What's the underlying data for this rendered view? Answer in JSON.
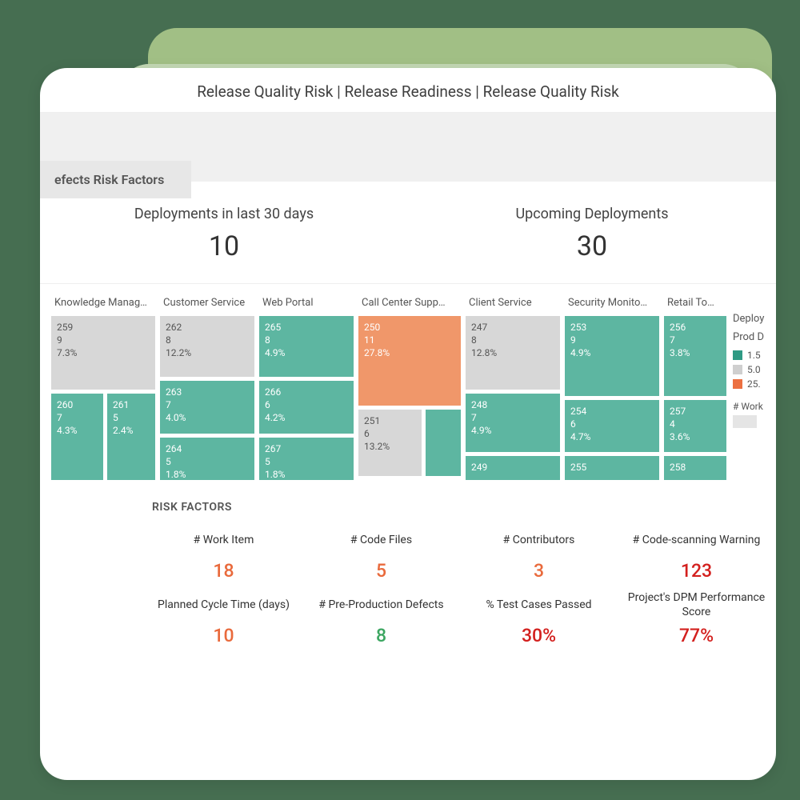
{
  "breadcrumb": "Release Quality Risk | Release Readiness | Release Quality Risk",
  "tab_label": "efects Risk Factors",
  "kpis": [
    {
      "label": "Deployments in last 30 days",
      "value": "10"
    },
    {
      "label": "Upcoming Deployments",
      "value": "30"
    }
  ],
  "legend": {
    "title1": "Deploy",
    "title2": "Prod D",
    "items": [
      {
        "swatch": "teal",
        "label": "1.5"
      },
      {
        "swatch": "gray",
        "label": "5.0"
      },
      {
        "swatch": "orange",
        "label": "25."
      }
    ],
    "footer": "# Work"
  },
  "risk_section_title": "RISK FACTORS",
  "risk_factors": [
    {
      "label": "# Work Item",
      "value": "18",
      "color": "orange"
    },
    {
      "label": "# Code Files",
      "value": "5",
      "color": "orange"
    },
    {
      "label": "# Contributors",
      "value": "3",
      "color": "orange"
    },
    {
      "label": "# Code-scanning Warning",
      "value": "123",
      "color": "red"
    },
    {
      "label": "Planned Cycle Time (days)",
      "value": "10",
      "color": "orange"
    },
    {
      "label": "# Pre-Production Defects",
      "value": "8",
      "color": "green"
    },
    {
      "label": "% Test Cases Passed",
      "value": "30%",
      "color": "red"
    },
    {
      "label": "Project's DPM Performance Score",
      "value": "77%",
      "color": "red"
    }
  ],
  "chart_data": {
    "type": "treemap",
    "title": "",
    "legend_title": "Deploy / Prod D",
    "color_scale": [
      {
        "label": "1.5",
        "color": "#2f9a84"
      },
      {
        "label": "5.0",
        "color": "#cfcfcf"
      },
      {
        "label": "25.",
        "color": "#ec7041"
      }
    ],
    "size_metric": "# Work",
    "groups": [
      {
        "name": "Knowledge Manag…",
        "cells": [
          {
            "id": "259",
            "v1": "9",
            "pct": "7.3%",
            "color": "gray"
          },
          {
            "id": "260",
            "v1": "7",
            "pct": "4.3%",
            "color": "teal"
          },
          {
            "id": "261",
            "v1": "5",
            "pct": "2.4%",
            "color": "teal"
          }
        ]
      },
      {
        "name": "Customer Service",
        "cells": [
          {
            "id": "262",
            "v1": "8",
            "pct": "12.2%",
            "color": "gray"
          },
          {
            "id": "263",
            "v1": "7",
            "pct": "4.0%",
            "color": "teal"
          },
          {
            "id": "264",
            "v1": "5",
            "pct": "1.8%",
            "color": "teal"
          }
        ]
      },
      {
        "name": "Web Portal",
        "cells": [
          {
            "id": "265",
            "v1": "8",
            "pct": "4.9%",
            "color": "teal"
          },
          {
            "id": "266",
            "v1": "6",
            "pct": "4.2%",
            "color": "teal"
          },
          {
            "id": "267",
            "v1": "5",
            "pct": "1.8%",
            "color": "teal"
          }
        ]
      },
      {
        "name": "Call Center Supp…",
        "cells": [
          {
            "id": "250",
            "v1": "11",
            "pct": "27.8%",
            "color": "orange"
          },
          {
            "id": "251",
            "v1": "6",
            "pct": "13.2%",
            "color": "gray"
          },
          {
            "id": "",
            "v1": "",
            "pct": "",
            "color": "teal"
          }
        ]
      },
      {
        "name": "Client Service",
        "cells": [
          {
            "id": "247",
            "v1": "8",
            "pct": "12.8%",
            "color": "gray"
          },
          {
            "id": "248",
            "v1": "7",
            "pct": "4.9%",
            "color": "teal"
          },
          {
            "id": "249",
            "v1": "",
            "pct": "",
            "color": "teal"
          }
        ]
      },
      {
        "name": "Security Monito…",
        "cells": [
          {
            "id": "253",
            "v1": "9",
            "pct": "4.9%",
            "color": "teal"
          },
          {
            "id": "254",
            "v1": "6",
            "pct": "4.7%",
            "color": "teal"
          },
          {
            "id": "255",
            "v1": "",
            "pct": "",
            "color": "teal"
          }
        ]
      },
      {
        "name": "Retail To…",
        "cells": [
          {
            "id": "256",
            "v1": "7",
            "pct": "3.8%",
            "color": "teal"
          },
          {
            "id": "257",
            "v1": "4",
            "pct": "3.6%",
            "color": "teal"
          },
          {
            "id": "258",
            "v1": "",
            "pct": "",
            "color": "teal"
          }
        ]
      }
    ]
  }
}
